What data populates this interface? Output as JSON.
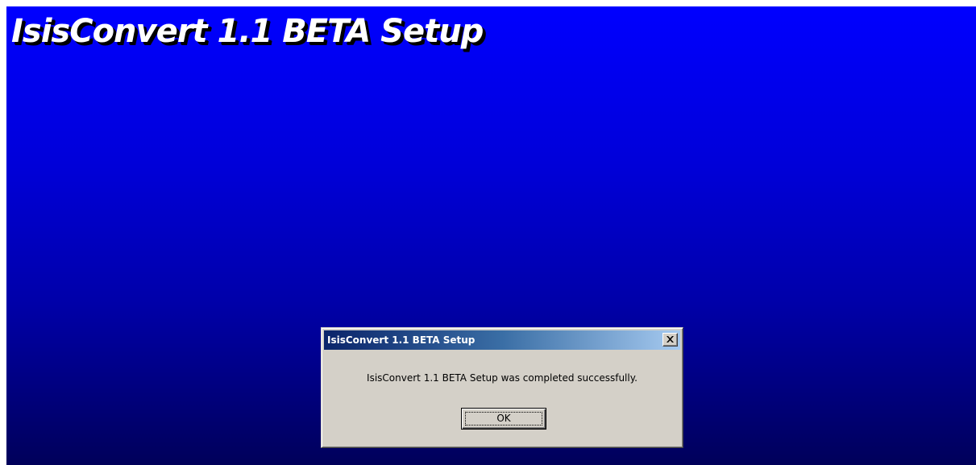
{
  "installer": {
    "title": "IsisConvert 1.1 BETA Setup",
    "background_top_color": "#0000ff",
    "background_bottom_color": "#00005a"
  },
  "dialog": {
    "title": "IsisConvert 1.1 BETA Setup",
    "message": "IsisConvert 1.1 BETA Setup was completed successfully.",
    "ok_label": "OK",
    "close_icon": "close-icon",
    "titlebar_color": "#0a246a",
    "face_color": "#d4d0c8"
  }
}
